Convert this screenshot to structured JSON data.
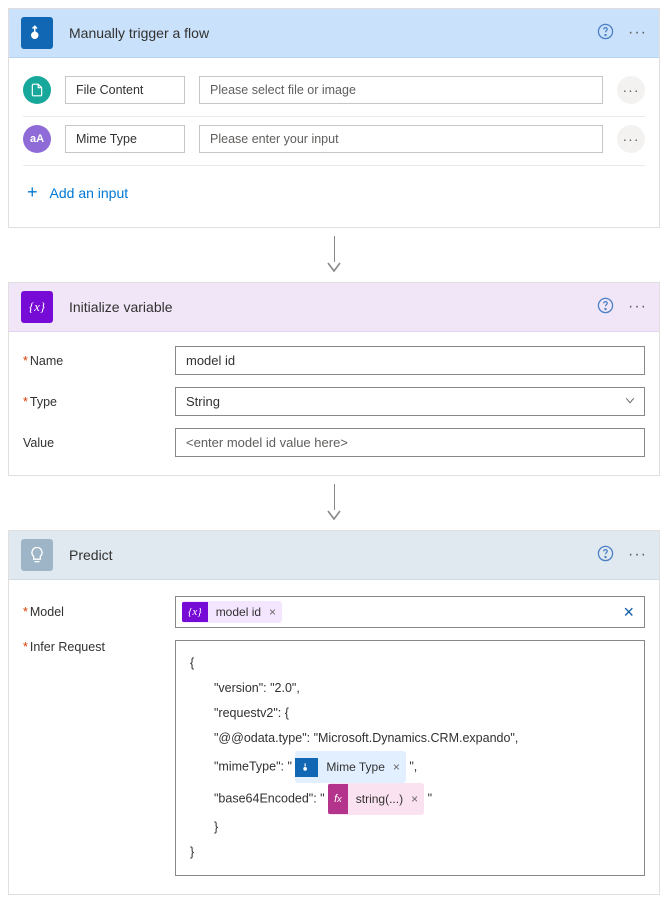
{
  "trigger": {
    "title": "Manually trigger a flow",
    "inputs": [
      {
        "icon": "file",
        "label": "File Content",
        "placeholder": "Please select file or image"
      },
      {
        "icon": "text",
        "label": "Mime Type",
        "placeholder": "Please enter your input"
      }
    ],
    "add_input": "Add an input"
  },
  "initvar": {
    "title": "Initialize variable",
    "name_label": "Name",
    "name_value": "model id",
    "type_label": "Type",
    "type_value": "String",
    "value_label": "Value",
    "value_placeholder": "<enter model id value here>"
  },
  "predict": {
    "title": "Predict",
    "model_label": "Model",
    "model_token": "model id",
    "infer_label": "Infer Request",
    "infer": {
      "open": "{",
      "l1": "\"version\": \"2.0\",",
      "l2": "\"requestv2\": {",
      "l3": "\"@@odata.type\": \"Microsoft.Dynamics.CRM.expando\",",
      "l4a": "\"mimeType\": \"",
      "l4tok": "Mime Type",
      "l4b": "\",",
      "l5a": "\"base64Encoded\": \"",
      "l5tok": "string(...)",
      "l5b": "\"",
      "close_inner": "}",
      "close_outer": "}"
    }
  }
}
